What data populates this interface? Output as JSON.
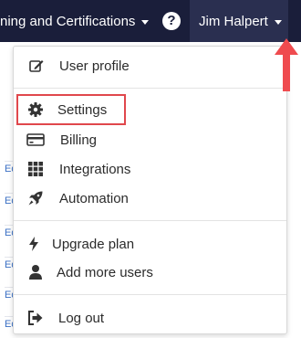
{
  "header": {
    "nav_label": "ning and Certifications",
    "help_icon": "?",
    "user_name": "Jim Halpert"
  },
  "sidebar_links": [
    "Ed",
    "Ed",
    "Ed",
    "Ed",
    "Ed",
    "Ed"
  ],
  "menu": {
    "user_profile": "User profile",
    "settings": "Settings",
    "billing": "Billing",
    "integrations": "Integrations",
    "automation": "Automation",
    "upgrade_plan": "Upgrade plan",
    "add_more_users": "Add more users",
    "log_out": "Log out"
  },
  "icons": {
    "user_profile": "edit-icon",
    "settings": "gear-icon",
    "billing": "credit-card-icon",
    "integrations": "grid-icon",
    "automation": "rocket-icon",
    "upgrade_plan": "bolt-icon",
    "add_more_users": "user-icon",
    "log_out": "sign-out-icon"
  },
  "colors": {
    "topbar": "#1a1e3a",
    "user_menu_bg": "#2a2f50",
    "highlight": "#e0474c",
    "arrow": "#ef4b4f",
    "link": "#3a6fc4"
  }
}
